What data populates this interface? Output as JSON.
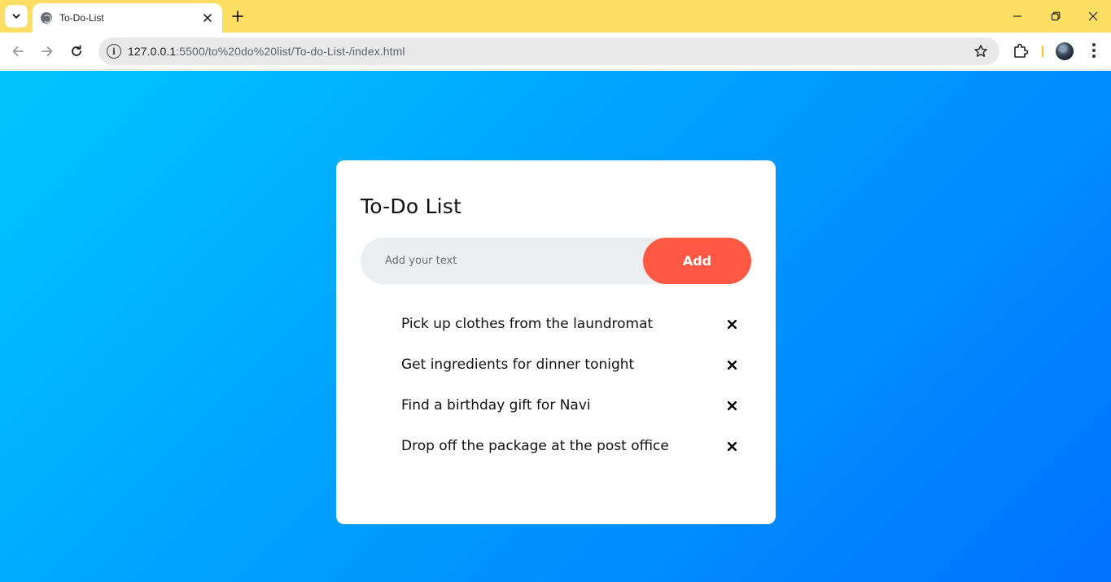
{
  "browser": {
    "tab_title": "To-Do-List",
    "url_host": "127.0.0.1",
    "url_rest": ":5500/to%20do%20list/To-do-List-/index.html"
  },
  "app": {
    "title": "To-Do List",
    "input_placeholder": "Add your text",
    "add_label": "Add",
    "tasks": [
      {
        "text": "Pick up clothes from the laundromat"
      },
      {
        "text": "Get ingredients for dinner tonight"
      },
      {
        "text": "Find a birthday gift for Navi"
      },
      {
        "text": "Drop off the package at the post office"
      }
    ]
  },
  "colors": {
    "tabbar": "#ffdf63",
    "gradient_start": "#00c6ff",
    "gradient_end": "#0072ff",
    "add_button": "#ff5945"
  },
  "icons": [
    "tab-list-icon",
    "globe-icon",
    "close-icon",
    "plus-icon",
    "minimize-icon",
    "restore-icon",
    "window-close-icon",
    "back-icon",
    "forward-icon",
    "reload-icon",
    "site-info-icon",
    "star-icon",
    "extensions-icon",
    "menu-icon",
    "remove-task-icon"
  ]
}
